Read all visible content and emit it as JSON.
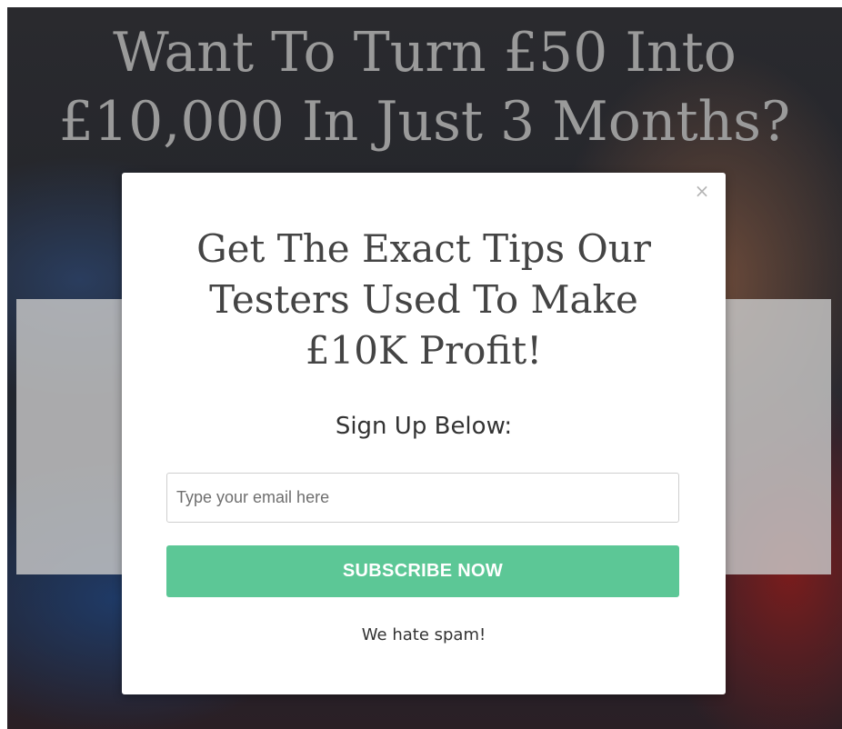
{
  "hero": {
    "title_line1": "Want To Turn £50 Into",
    "title_line2": "£10,000 In Just 3 Months?"
  },
  "modal": {
    "close_glyph": "×",
    "headline_line1": "Get The Exact Tips Our",
    "headline_line2": "Testers Used To Make",
    "headline_line3": "£10K Profit!",
    "subheadline": "Sign Up Below:",
    "email_placeholder": "Type your email here",
    "email_value": "",
    "subscribe_label": "SUBSCRIBE NOW",
    "spam_note": "We hate spam!"
  },
  "colors": {
    "button": "#5cc796",
    "overlay_panel": "#c8c8c8",
    "hero_title": "#9a9a9a"
  },
  "icons": {
    "close": "close-icon"
  }
}
